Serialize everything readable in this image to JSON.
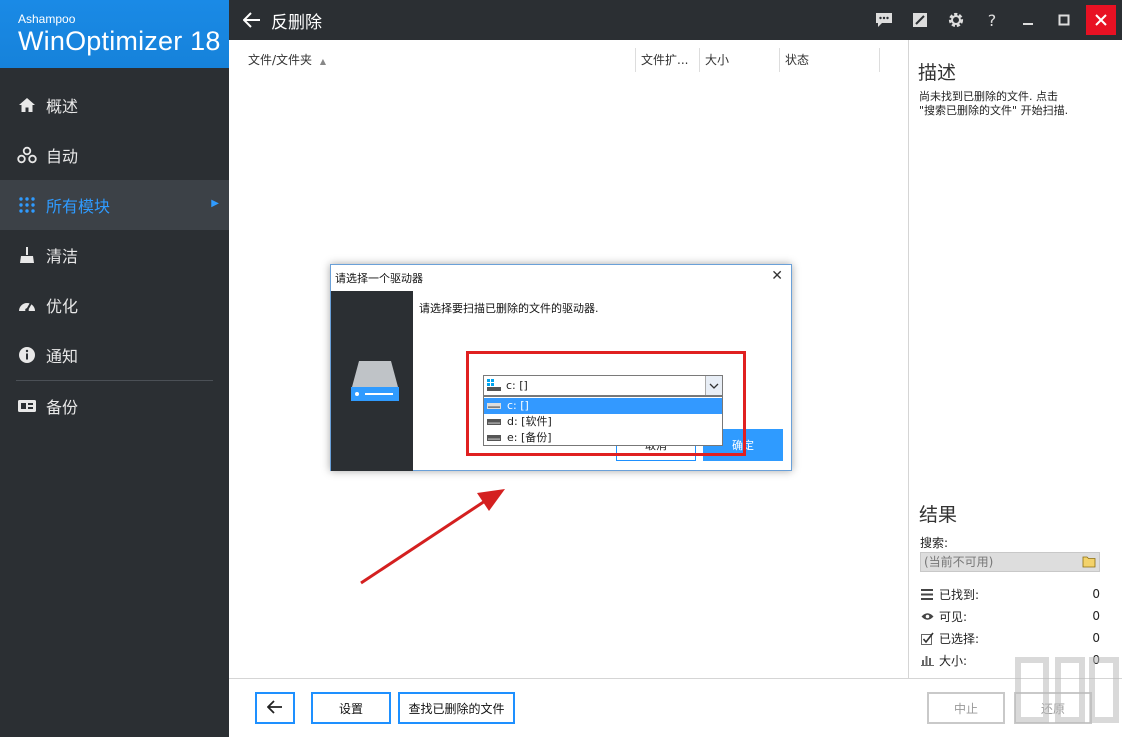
{
  "app": {
    "brand_small": "Ashampoo",
    "brand_name": "WinOptimizer 18"
  },
  "sidebar": {
    "items": [
      {
        "label": "概述",
        "icon": "home-icon"
      },
      {
        "label": "自动",
        "icon": "automation-icon"
      },
      {
        "label": "所有模块",
        "icon": "grid-dots-icon",
        "active": true
      },
      {
        "label": "清洁",
        "icon": "broom-icon"
      },
      {
        "label": "优化",
        "icon": "speedometer-icon"
      },
      {
        "label": "通知",
        "icon": "info-icon"
      },
      {
        "label": "备份",
        "icon": "backup-icon"
      }
    ]
  },
  "titlebar": {
    "title": "反删除",
    "tools": [
      "chat-icon",
      "note-icon",
      "gear-icon",
      "help-icon",
      "minimize-icon",
      "maximize-icon",
      "close-icon"
    ],
    "help_glyph": "?"
  },
  "filelist": {
    "columns": [
      "文件/文件夹",
      "文件扩...",
      "大小",
      "状态"
    ]
  },
  "description": {
    "heading": "描述",
    "text_line1": "尚未找到已删除的文件. 点击",
    "text_line2": "\"搜索已删除的文件\" 开始扫描."
  },
  "results": {
    "heading": "结果",
    "search_label": "搜索:",
    "search_placeholder": "(当前不可用)",
    "rows": [
      {
        "label": "已找到:",
        "value": "0",
        "icon": "list-icon"
      },
      {
        "label": "可见:",
        "value": "0",
        "icon": "eye-icon"
      },
      {
        "label": "已选择:",
        "value": "0",
        "icon": "checkmark-icon"
      },
      {
        "label": "大小:",
        "value": "0",
        "icon": "bar-chart-icon"
      }
    ]
  },
  "bottombar": {
    "settings_label": "设置",
    "find_label": "查找已删除的文件",
    "stop_label": "中止",
    "restore_label": "还原"
  },
  "dialog": {
    "title": "请选择一个驱动器",
    "prompt": "请选择要扫描已删除的文件的驱动器.",
    "selected_drive": "c: []",
    "drives": [
      "c: []",
      "d: [软件]",
      "e: [备份]"
    ],
    "cancel_label": "取消",
    "ok_label": "确定"
  },
  "colors": {
    "accent": "#1e90ff",
    "sidebar_bg": "#2b2f33",
    "annotation": "#e02020"
  }
}
